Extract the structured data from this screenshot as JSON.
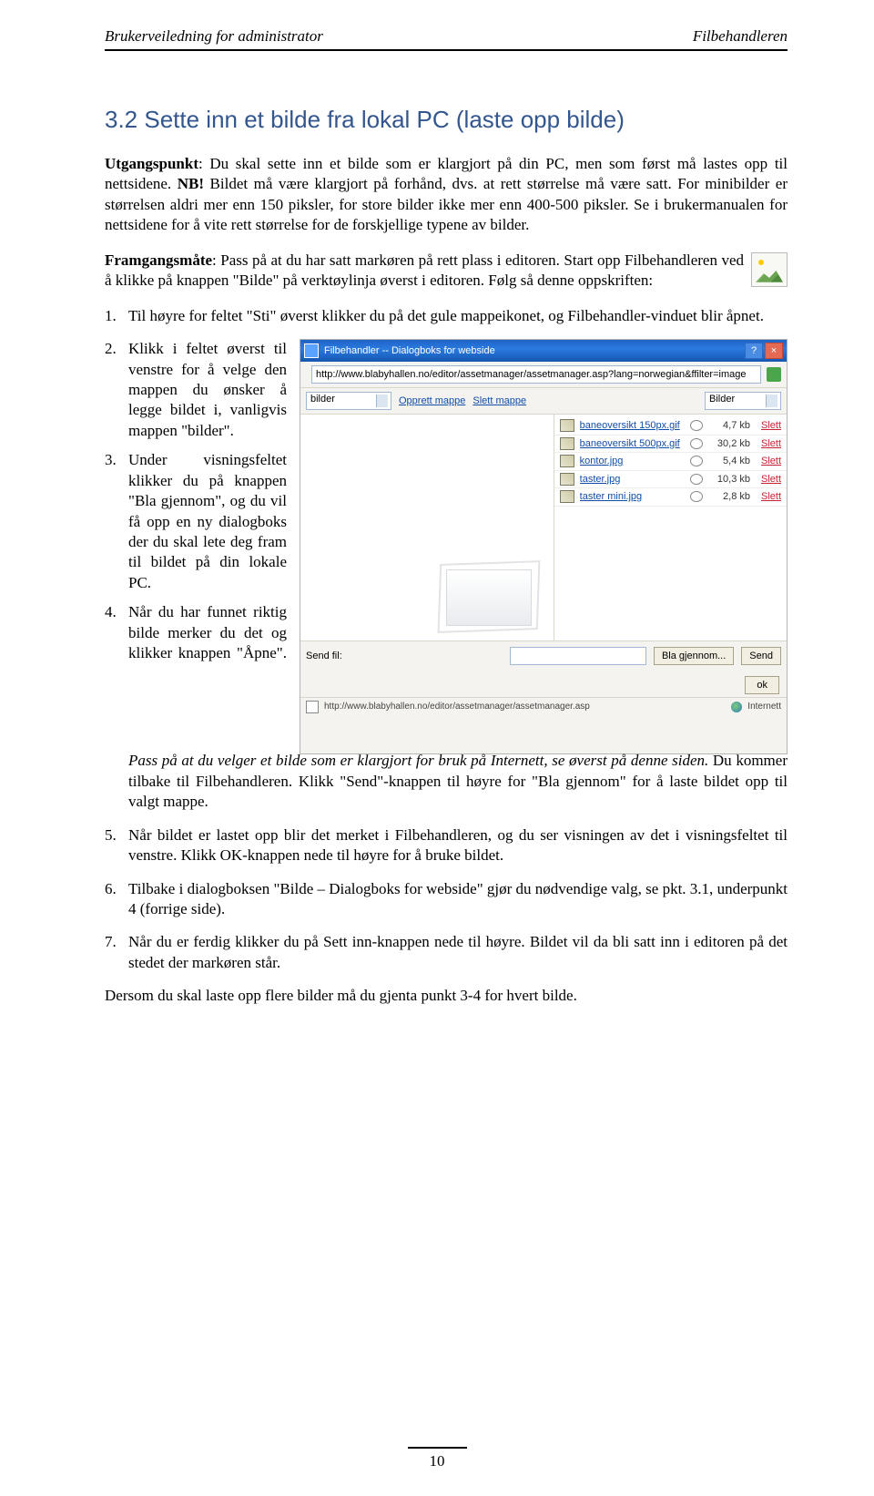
{
  "header": {
    "left": "Brukerveiledning for administrator",
    "right": "Filbehandleren"
  },
  "section_title": "3.2 Sette inn et bilde fra lokal PC (laste opp bilde)",
  "intro": {
    "p1_a": "Utgangspunkt",
    "p1_b": ": Du skal sette inn et bilde som er klargjort på din PC, men som først må lastes opp til nettsidene. ",
    "p1_c": "NB!",
    "p1_d": " Bildet må være klargjort på forhånd, dvs. at rett størrelse må være satt. For minibilder er størrelsen aldri mer enn 150 piksler, for store bilder ikke mer enn 400-500 piksler. Se i brukermanualen for nettsidene for å vite rett størrelse for de forskjellige typene av bilder.",
    "p2_a": "Framgangsmåte",
    "p2_b": ": Pass på at du har satt markøren på rett plass i editoren. Start opp Filbehandleren ved å klikke på knappen \"Bilde\" på verktøylinja øverst i editoren. Følg så denne oppskriften:"
  },
  "steps": {
    "s1": "Til høyre for feltet \"Sti\" øverst klikker du på det gule mappeikonet, og Filbehandler-vinduet blir åpnet.",
    "s2": "Klikk i feltet øverst til venstre for å velge den mappen du ønsker å legge bildet i, vanligvis mappen \"bilder\".",
    "s3": "Under visningsfeltet klikker du på knappen \"Bla gjennom\", og du vil få opp en ny dialogboks der du skal lete deg fram til bildet på din lokale PC.",
    "s4_a": "Når du har funnet riktig bilde merker du det og klikker knappen \"Åpne\". ",
    "s4_b": "Pass på at du velger et bilde som er klargjort for bruk på Internett, se øverst på denne siden.",
    "s4_c": " Du kommer tilbake til Filbehandleren. Klikk \"Send\"-knappen til høyre for \"Bla gjennom\" for å laste bildet opp til valgt mappe.",
    "s5": "Når bildet er lastet opp blir det merket i Filbehandleren, og du ser visningen av det i visningsfeltet til venstre. Klikk OK-knappen nede til høyre for å bruke bildet.",
    "s6": "Tilbake i dialogboksen \"Bilde – Dialogboks for webside\" gjør du nødvendige valg, se pkt. 3.1, underpunkt 4 (forrige side).",
    "s7": "Når du er ferdig klikker du på Sett inn-knappen nede til høyre. Bildet vil da bli satt inn i editoren på det stedet der markøren står."
  },
  "closing": "Dersom du skal laste opp flere bilder må du gjenta punkt 3-4 for hvert bilde.",
  "page_number": "10",
  "dialog": {
    "title": "Filbehandler -- Dialogboks for webside",
    "url": "http://www.blabyhallen.no/editor/assetmanager/assetmanager.asp?lang=norwegian&ffilter=image",
    "folder_select": "bilder",
    "link_create": "Opprett mappe",
    "link_delete": "Slett mappe",
    "filter_select": "Bilder",
    "files": [
      {
        "name": "baneoversikt 150px.gif",
        "size": "4,7 kb"
      },
      {
        "name": "baneoversikt 500px.gif",
        "size": "30,2 kb"
      },
      {
        "name": "kontor.jpg",
        "size": "5,4 kb"
      },
      {
        "name": "taster.jpg",
        "size": "10,3 kb"
      },
      {
        "name": "taster mini.jpg",
        "size": "2,8 kb"
      }
    ],
    "delete_label": "Slett",
    "send_label": "Send fil:",
    "browse_btn": "Bla gjennom...",
    "send_btn": "Send",
    "ok_btn": "ok",
    "status_url": "http://www.blabyhallen.no/editor/assetmanager/assetmanager.asp",
    "status_zone": "Internett"
  }
}
